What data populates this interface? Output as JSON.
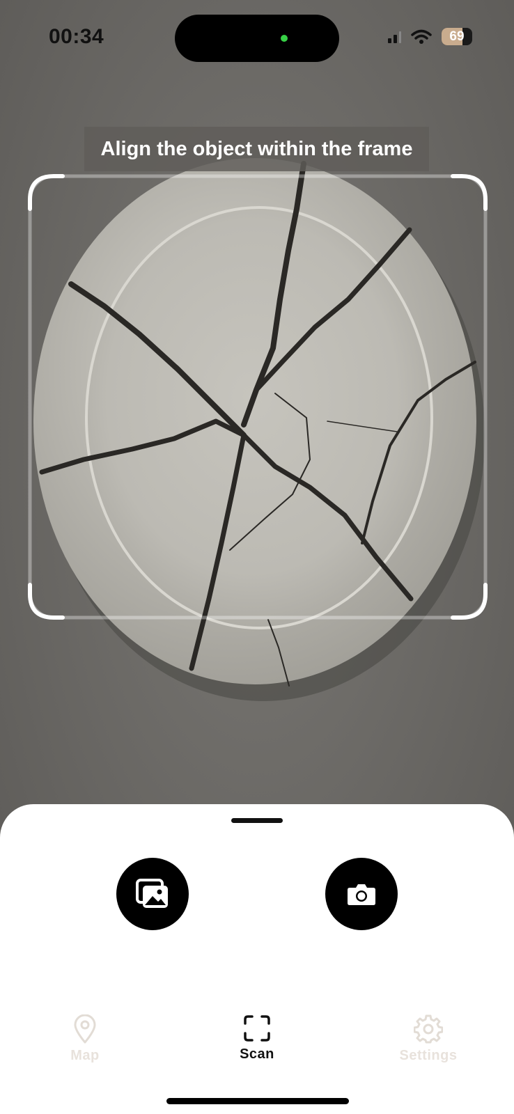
{
  "status_bar": {
    "time": "00:34",
    "battery_level": 69,
    "battery_text": "69",
    "icons": [
      "cellular-signal-icon",
      "wifi-icon",
      "battery-icon"
    ]
  },
  "camera": {
    "instruction": "Align the object within the frame",
    "subject": "broken-plate"
  },
  "bottom_sheet": {
    "buttons": [
      {
        "name": "gallery-button",
        "icon": "photo-gallery-icon"
      },
      {
        "name": "camera-button",
        "icon": "camera-icon"
      }
    ]
  },
  "tab_bar": {
    "tabs": [
      {
        "label": "Map",
        "icon": "map-pin-icon",
        "active": false
      },
      {
        "label": "Scan",
        "icon": "scan-frame-icon",
        "active": true
      },
      {
        "label": "Settings",
        "icon": "gear-icon",
        "active": false
      }
    ],
    "active_color": "#111111",
    "inactive_color": "#e8e2dc"
  },
  "colors": {
    "sheet_background": "#ffffff",
    "button_background": "#000000",
    "camera_background": "#6f6d69"
  }
}
